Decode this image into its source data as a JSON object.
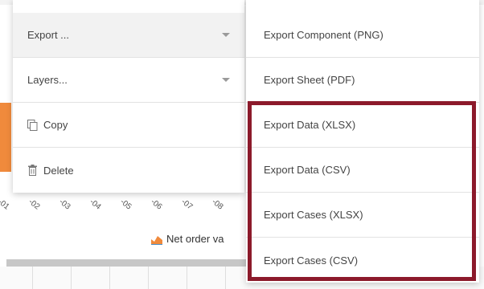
{
  "colors": {
    "highlight": "#8c1a2b",
    "chart_area": "#f08a3c",
    "menu_text": "#444444",
    "divider": "#e2e2e2"
  },
  "menu": {
    "items": [
      {
        "label": "Export ...",
        "has_submenu": true,
        "active": true
      },
      {
        "label": "Layers...",
        "has_submenu": true
      },
      {
        "label": "Copy",
        "icon": "copy-icon"
      },
      {
        "label": "Delete",
        "icon": "trash-icon"
      }
    ]
  },
  "submenu": {
    "items": [
      {
        "label": "Export Component (PNG)"
      },
      {
        "label": "Export Sheet (PDF)"
      },
      {
        "label": "Export Data (XLSX)"
      },
      {
        "label": "Export Data (CSV)"
      },
      {
        "label": "Export Cases (XLSX)"
      },
      {
        "label": "Export Cases (CSV)"
      }
    ]
  },
  "chart": {
    "x_ticks": [
      "-01",
      "-02",
      "-03",
      "-04",
      "-05",
      "-06",
      "-07",
      "-08"
    ],
    "legend_label": "Net order va",
    "legend_icon": "area-chart-icon"
  }
}
